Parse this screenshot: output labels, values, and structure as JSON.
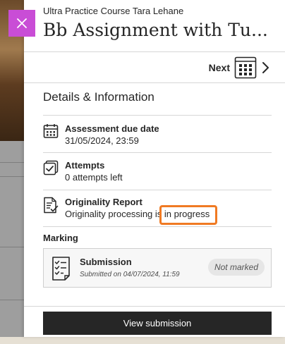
{
  "header": {
    "course_name": "Ultra Practice Course Tara Lehane",
    "title": "Bb Assignment with Tu...",
    "close_icon": "close-icon",
    "accent_color": "#c94dd6"
  },
  "nav": {
    "next_label": "Next",
    "grid_icon": "grid-icon",
    "chevron_icon": "chevron-right-icon"
  },
  "details": {
    "section_title": "Details & Information",
    "items": [
      {
        "label": "Assessment due date",
        "value": "31/05/2024, 23:59",
        "icon": "calendar-icon"
      },
      {
        "label": "Attempts",
        "value": "0 attempts left",
        "icon": "attempts-icon"
      },
      {
        "label": "Originality Report",
        "value": "Originality processing is in progress",
        "icon": "originality-report-icon"
      }
    ]
  },
  "marking": {
    "title": "Marking",
    "submission": {
      "title": "Submission",
      "date": "Submitted on 04/07/2024, 11:59",
      "status": "Not marked",
      "icon": "submission-checklist-icon"
    }
  },
  "footer": {
    "view_button": "View submission"
  },
  "colors": {
    "highlight": "#f07a23",
    "primary_button": "#262626"
  }
}
